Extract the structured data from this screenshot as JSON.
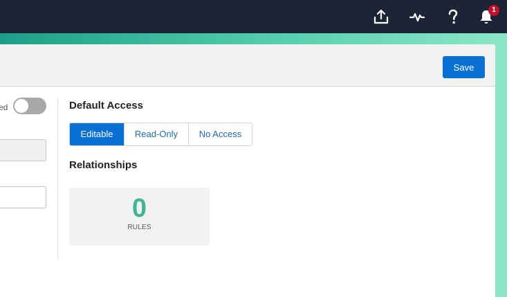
{
  "topbar": {
    "icons": [
      "upload-icon",
      "activity-icon",
      "help-icon",
      "notifications-icon"
    ],
    "notification_count": "1",
    "colors": {
      "background": "#1b2535",
      "badge": "#c0122b"
    }
  },
  "header": {
    "save_label": "Save"
  },
  "form": {
    "toggle_label_partial": "ed",
    "toggle_on": false
  },
  "default_access": {
    "title": "Default Access",
    "options": [
      "Editable",
      "Read-Only",
      "No Access"
    ],
    "selected": "Editable"
  },
  "relationships": {
    "title": "Relationships",
    "rules_count": "0",
    "rules_label": "RULES"
  },
  "colors": {
    "accent": "#0870d3",
    "count": "#41b493"
  }
}
